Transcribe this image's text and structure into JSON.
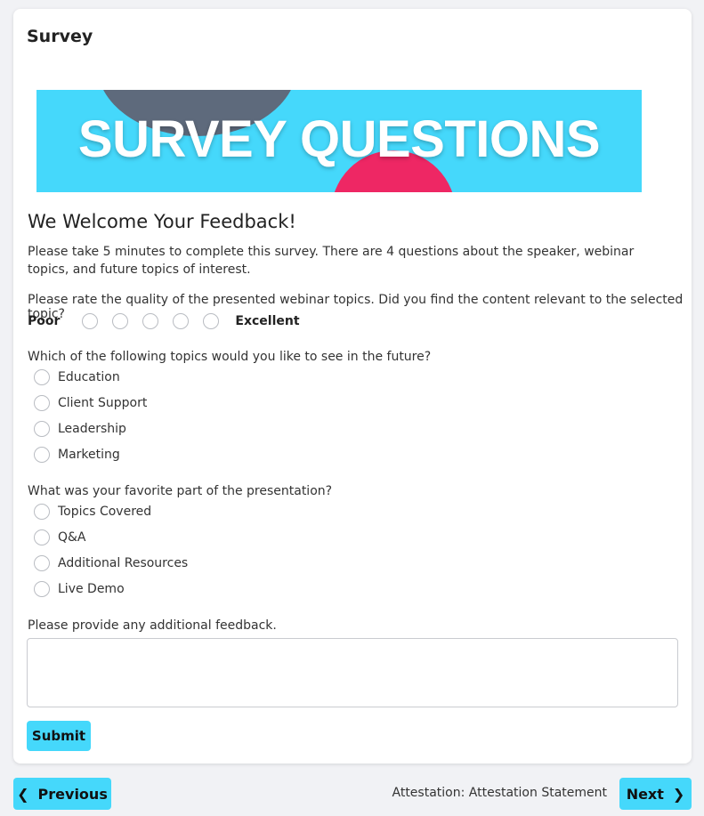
{
  "card": {
    "title": "Survey"
  },
  "banner": {
    "text": "SURVEY QUESTIONS",
    "colors": {
      "background": "#45d8fb",
      "dark_blob": "#5e6a7c",
      "pink_blob": "#ee2764"
    }
  },
  "survey": {
    "heading": "We Welcome Your Feedback!",
    "intro": "Please take 5 minutes to complete this survey. There are 4 questions about the speaker, webinar topics, and future topics of interest.",
    "q1": {
      "text": "Please rate the quality of the presented webinar topics. Did you find the content relevant to the selected topic?",
      "low_label": "Poor",
      "high_label": "Excellent",
      "scale_count": 5
    },
    "q2": {
      "text": "Which of the following topics would you like to see in the future?",
      "options": [
        "Education",
        "Client Support",
        "Leadership",
        "Marketing"
      ]
    },
    "q3": {
      "text": "What was your favorite part of the presentation?",
      "options": [
        "Topics Covered",
        "Q&A",
        "Additional Resources",
        "Live Demo"
      ]
    },
    "q4": {
      "text": "Please provide any additional feedback.",
      "value": ""
    },
    "submit_label": "Submit"
  },
  "nav": {
    "previous_label": "Previous",
    "next_label": "Next",
    "next_section": "Attestation: Attestation Statement",
    "accent": "#45d8fb"
  }
}
